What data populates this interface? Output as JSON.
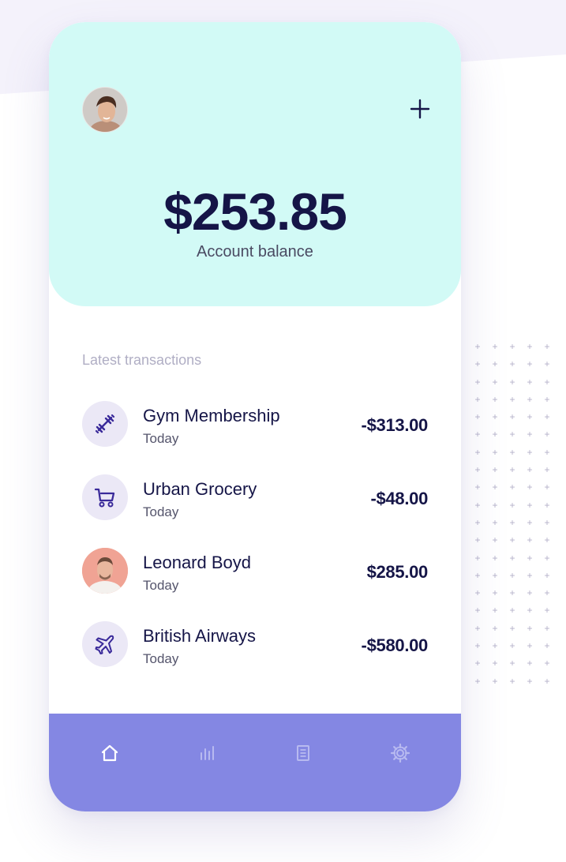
{
  "header": {
    "balance": "$253.85",
    "balance_label": "Account balance",
    "add_icon": "plus-icon",
    "accent_color": "#d2faf6"
  },
  "transactions": {
    "title": "Latest transactions",
    "items": [
      {
        "name": "Gym Membership",
        "date": "Today",
        "amount": "-$313.00",
        "icon": "dumbbell-icon"
      },
      {
        "name": "Urban Grocery",
        "date": "Today",
        "amount": "-$48.00",
        "icon": "shopping-cart-icon"
      },
      {
        "name": "Leonard Boyd",
        "date": "Today",
        "amount": "$285.00",
        "icon": "contact-avatar"
      },
      {
        "name": "British Airways",
        "date": "Today",
        "amount": "-$580.00",
        "icon": "airplane-icon"
      }
    ]
  },
  "nav": {
    "items": [
      {
        "icon": "home-icon",
        "active": true
      },
      {
        "icon": "bar-chart-icon",
        "active": false
      },
      {
        "icon": "document-icon",
        "active": false
      },
      {
        "icon": "gear-icon",
        "active": false
      }
    ],
    "color": "#8487e3"
  }
}
